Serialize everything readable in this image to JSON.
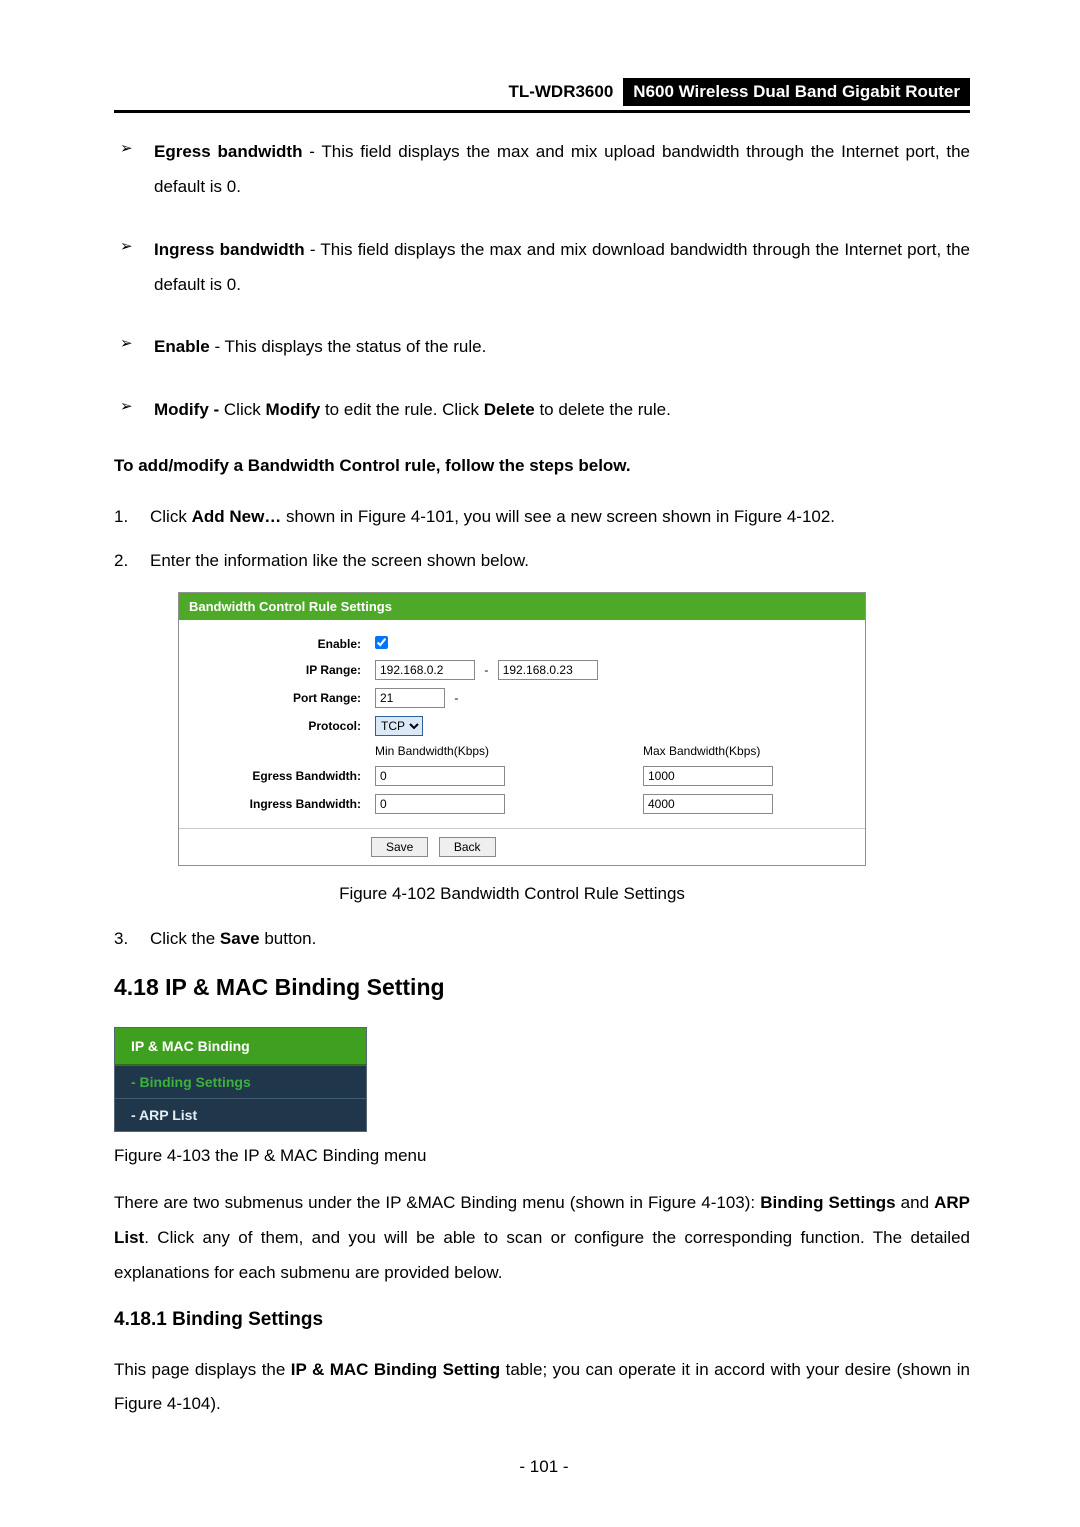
{
  "header": {
    "model": "TL-WDR3600",
    "title": "N600 Wireless Dual Band Gigabit Router"
  },
  "bullets": {
    "items": [
      {
        "term": "Egress bandwidth",
        "rest": " - This field displays the max and mix upload bandwidth through the Internet port, the default is 0."
      },
      {
        "term": "Ingress bandwidth",
        "rest": " - This field displays the max and mix download bandwidth through the Internet port, the default is 0."
      },
      {
        "term": "Enable",
        "rest": " - This displays the status of the rule."
      }
    ],
    "modify": {
      "pre": "Modify - ",
      "mid1": "Click ",
      "b1": "Modify",
      "mid2": " to edit the rule. Click ",
      "b2": "Delete",
      "post": " to delete the rule."
    }
  },
  "instr": "To add/modify a Bandwidth Control rule, follow the steps below.",
  "steps": {
    "s1": {
      "num": "1.",
      "pre": "Click ",
      "bold": "Add New…",
      "post": " shown in Figure 4-101, you will see a new screen shown in Figure 4-102."
    },
    "s2": {
      "num": "2.",
      "txt": "Enter the information like the screen shown below."
    },
    "s3": {
      "num": "3.",
      "pre": "Click the ",
      "bold": "Save",
      "post": " button."
    }
  },
  "panel": {
    "title": "Bandwidth Control Rule Settings",
    "labels": {
      "enable": "Enable:",
      "iprange": "IP Range:",
      "portrange": "Port Range:",
      "protocol": "Protocol:",
      "egress": "Egress Bandwidth:",
      "ingress": "Ingress Bandwidth:"
    },
    "values": {
      "ip1": "192.168.0.2",
      "ip2": "192.168.0.23",
      "port1": "21",
      "protocol": "TCP",
      "colMin": "Min Bandwidth(Kbps)",
      "colMax": "Max Bandwidth(Kbps)",
      "egMin": "0",
      "egMax": "1000",
      "inMin": "0",
      "inMax": "4000"
    },
    "buttons": {
      "save": "Save",
      "back": "Back"
    }
  },
  "fig102": "Figure 4-102 Bandwidth Control Rule Settings",
  "sec418": "4.18  IP & MAC Binding Setting",
  "menu": {
    "head": "IP & MAC Binding",
    "item1": "- Binding Settings",
    "item2": "- ARP List"
  },
  "fig103": "Figure 4-103 the IP & MAC Binding menu",
  "para1": {
    "p1": "There are two submenus under the IP &MAC Binding menu (shown in Figure 4-103): ",
    "b1": "Binding Settings",
    "p2": " and ",
    "b2": "ARP List",
    "p3": ". Click any of them, and you will be able to scan or configure the corresponding function. The detailed explanations for each submenu are provided below."
  },
  "sec4181": "4.18.1  Binding Settings",
  "para2": {
    "p1": "This page displays the ",
    "b1": "IP & MAC Binding Setting",
    "p2": " table; you can operate it in accord with your desire (shown in Figure 4-104)."
  },
  "pageNum": "- 101 -"
}
